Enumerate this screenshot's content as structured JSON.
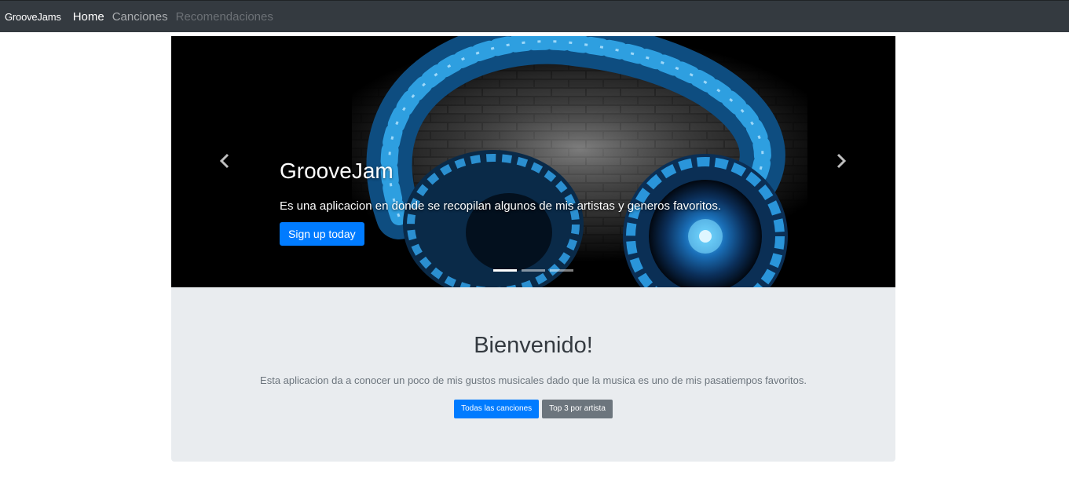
{
  "navbar": {
    "brand": "GrooveJams",
    "links": [
      {
        "label": "Home",
        "state": "active"
      },
      {
        "label": "Canciones",
        "state": "normal"
      },
      {
        "label": "Recomendaciones",
        "state": "disabled"
      }
    ]
  },
  "carousel": {
    "title": "GrooveJam",
    "text": "Es una aplicacion en donde se recopilan algunos de mis artistas y generos favoritos.",
    "button_label": "Sign up today",
    "prev_icon": "chevron-left-icon",
    "next_icon": "chevron-right-icon",
    "slide_count": 3,
    "active_slide": 1
  },
  "jumbotron": {
    "heading": "Bienvenido!",
    "lead": "Esta aplicacion da a conocer un poco de mis gustos musicales dado que la musica es uno de mis pasatiempos favoritos.",
    "primary_button": "Todas las canciones",
    "secondary_button": "Top 3 por artista"
  },
  "colors": {
    "navbar_bg": "#343a40",
    "primary": "#007bff",
    "secondary": "#6c757d",
    "jumbotron_bg": "#e9ecef",
    "headphone_accent": "#1e90d6"
  }
}
